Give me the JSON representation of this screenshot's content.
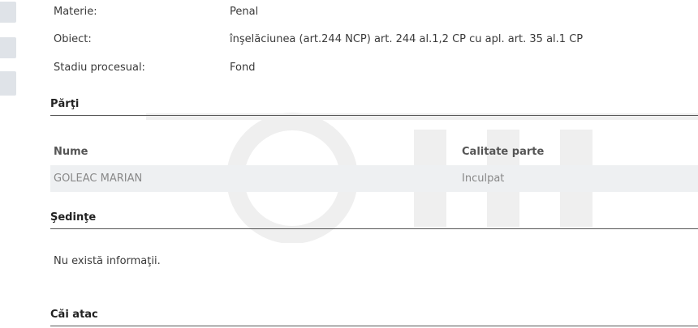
{
  "case_info": {
    "rows": [
      {
        "label": "Materie:",
        "value": "Penal"
      },
      {
        "label": "Obiect:",
        "value": "înşelăciunea (art.244 NCP) art. 244 al.1,2 CP cu apl. art. 35 al.1 CP"
      },
      {
        "label": "Stadiu procesual:",
        "value": "Fond"
      }
    ]
  },
  "parti": {
    "title": "Părţi",
    "columns": [
      "Nume",
      "Calitate parte"
    ],
    "rows": [
      {
        "nume": "GOLEAC MARIAN",
        "calitate": "Inculpat"
      }
    ]
  },
  "sedinte": {
    "title": "Şedinţe",
    "empty_text": "Nu există informaţii."
  },
  "cai_atac": {
    "title": "Căi atac"
  },
  "colors": {
    "row_bg": "#eef0f2",
    "tab_bg": "#dfe3e8",
    "divider": "#555555"
  }
}
